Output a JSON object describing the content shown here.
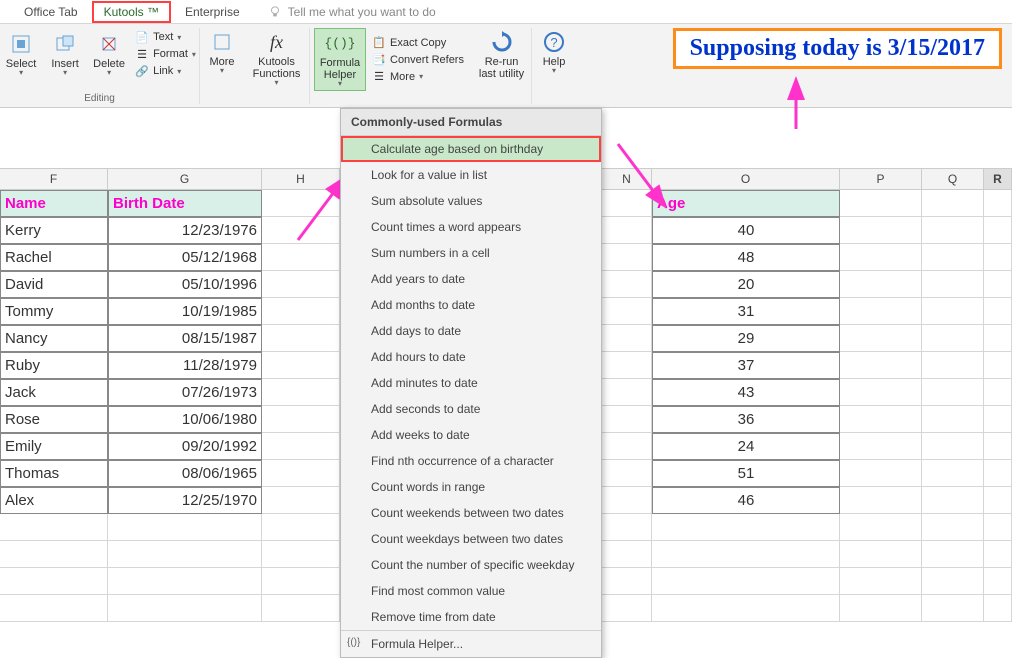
{
  "tabs": {
    "office": "Office Tab",
    "kutools": "Kutools ™",
    "enterprise": "Enterprise",
    "tellme": "Tell me what you want to do"
  },
  "ribbon": {
    "select": "Select",
    "insert": "Insert",
    "delete": "Delete",
    "text": "Text",
    "format": "Format",
    "link": "Link",
    "more1": "More",
    "editing_group": "Editing",
    "kutools_functions": "Kutools\nFunctions",
    "formula_helper": "Formula\nHelper",
    "exact_copy": "Exact Copy",
    "convert_refers": "Convert Refers",
    "more2": "More",
    "rerun": "Re-run\nlast utility",
    "help": "Help"
  },
  "callout": "Supposing today is 3/15/2017",
  "cols": [
    "F",
    "G",
    "H",
    "",
    "",
    "N",
    "O",
    "P",
    "Q",
    "R"
  ],
  "headers": {
    "name": "Name",
    "birth": "Birth Date",
    "age": "Age"
  },
  "rows": [
    {
      "name": "Kerry",
      "birth": "12/23/1976",
      "age": "40"
    },
    {
      "name": "Rachel",
      "birth": "05/12/1968",
      "age": "48"
    },
    {
      "name": "David",
      "birth": "05/10/1996",
      "age": "20"
    },
    {
      "name": "Tommy",
      "birth": "10/19/1985",
      "age": "31"
    },
    {
      "name": "Nancy",
      "birth": "08/15/1987",
      "age": "29"
    },
    {
      "name": "Ruby",
      "birth": "11/28/1979",
      "age": "37"
    },
    {
      "name": "Jack",
      "birth": "07/26/1973",
      "age": "43"
    },
    {
      "name": "Rose",
      "birth": "10/06/1980",
      "age": "36"
    },
    {
      "name": "Emily",
      "birth": "09/20/1992",
      "age": "24"
    },
    {
      "name": "Thomas",
      "birth": "08/06/1965",
      "age": "51"
    },
    {
      "name": "Alex",
      "birth": "12/25/1970",
      "age": "46"
    }
  ],
  "dropdown": {
    "header": "Commonly-used Formulas",
    "items": [
      "Calculate age based on birthday",
      "Look for a value in list",
      "Sum absolute values",
      "Count times a word appears",
      "Sum numbers in a cell",
      "Add years to date",
      "Add months to date",
      "Add days to date",
      "Add hours to date",
      "Add minutes to date",
      "Add seconds to date",
      "Add weeks to date",
      "Find nth occurrence of a character",
      "Count words in range",
      "Count weekends between two dates",
      "Count weekdays between two dates",
      "Count the number of specific weekday",
      "Find most common value",
      "Remove time from date"
    ],
    "footer": "Formula Helper..."
  },
  "colors": {
    "pinkText": "#ff00cc",
    "headerBg": "#d8f0e8",
    "green": "#c9e8c9"
  },
  "col_widths": {
    "F": 108,
    "G": 154,
    "H": 78,
    "gap": 262,
    "N": 50,
    "O": 188,
    "P": 82,
    "Q": 62,
    "R": 28
  }
}
